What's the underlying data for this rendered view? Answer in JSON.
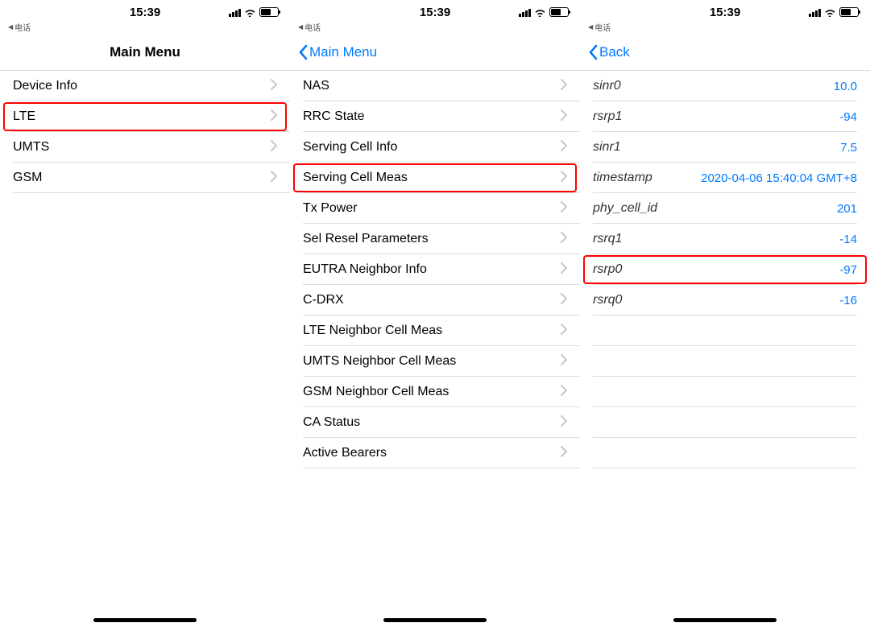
{
  "status": {
    "time": "15:39",
    "breadcrumb_arrow": "◀",
    "breadcrumb_text": "电话"
  },
  "screen1": {
    "title": "Main Menu",
    "items": [
      {
        "label": "Device Info",
        "highlight": false
      },
      {
        "label": "LTE",
        "highlight": true
      },
      {
        "label": "UMTS",
        "highlight": false
      },
      {
        "label": "GSM",
        "highlight": false
      }
    ]
  },
  "screen2": {
    "back_label": "Main Menu",
    "items": [
      {
        "label": "NAS",
        "highlight": false
      },
      {
        "label": "RRC State",
        "highlight": false
      },
      {
        "label": "Serving Cell Info",
        "highlight": false
      },
      {
        "label": "Serving Cell Meas",
        "highlight": true
      },
      {
        "label": "Tx Power",
        "highlight": false
      },
      {
        "label": "Sel Resel Parameters",
        "highlight": false
      },
      {
        "label": "EUTRA Neighbor Info",
        "highlight": false
      },
      {
        "label": "C-DRX",
        "highlight": false
      },
      {
        "label": "LTE Neighbor Cell Meas",
        "highlight": false
      },
      {
        "label": "UMTS Neighbor Cell Meas",
        "highlight": false
      },
      {
        "label": "GSM Neighbor Cell Meas",
        "highlight": false
      },
      {
        "label": "CA Status",
        "highlight": false
      },
      {
        "label": "Active Bearers",
        "highlight": false
      }
    ]
  },
  "screen3": {
    "back_label": "Back",
    "items": [
      {
        "label": "sinr0",
        "value": "10.0",
        "highlight": false
      },
      {
        "label": "rsrp1",
        "value": "-94",
        "highlight": false
      },
      {
        "label": "sinr1",
        "value": "7.5",
        "highlight": false
      },
      {
        "label": "timestamp",
        "value": "2020-04-06 15:40:04 GMT+8",
        "highlight": false
      },
      {
        "label": "phy_cell_id",
        "value": "201",
        "highlight": false
      },
      {
        "label": "rsrq1",
        "value": "-14",
        "highlight": false
      },
      {
        "label": "rsrp0",
        "value": "-97",
        "highlight": true
      },
      {
        "label": "rsrq0",
        "value": "-16",
        "highlight": false
      }
    ],
    "blank_rows": 5
  }
}
